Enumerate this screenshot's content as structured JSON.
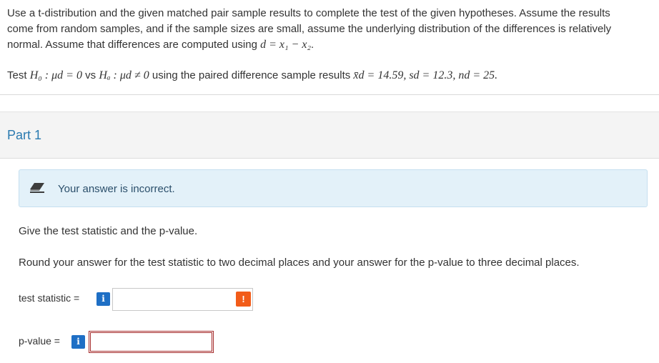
{
  "problem": {
    "intro": "Use a t-distribution and the given matched pair sample results to complete the test of the given hypotheses. Assume the results come from random samples, and if the sample sizes are small, assume the underlying distribution of the differences is relatively normal. Assume that differences are computed using",
    "diff_formula": "d = x₁ − x₂",
    "test_prefix": "Test",
    "h0": "H₀ : μd = 0",
    "vs": "vs",
    "ha": "Hₐ : μd ≠ 0",
    "using_text": "using the paired difference sample results",
    "results": "x̄d = 14.59, sd = 12.3, nd = 25."
  },
  "part": {
    "title": "Part 1"
  },
  "feedback": {
    "message": "Your answer is incorrect."
  },
  "question": {
    "line1": "Give the test statistic and the p-value.",
    "line2": "Round your answer for the test statistic to two decimal places and your answer for the p-value to three decimal places."
  },
  "fields": {
    "test_statistic": {
      "label": "test statistic =",
      "value": "",
      "info": "i",
      "warning": "!"
    },
    "p_value": {
      "label": "p-value =",
      "value": "",
      "info": "i"
    }
  },
  "colors": {
    "part_title": "#2a7ab0",
    "info_button": "#1e6fc5",
    "warning": "#f25c19",
    "alert_bg": "#e3f1f9",
    "error_border": "#a52a2a"
  }
}
